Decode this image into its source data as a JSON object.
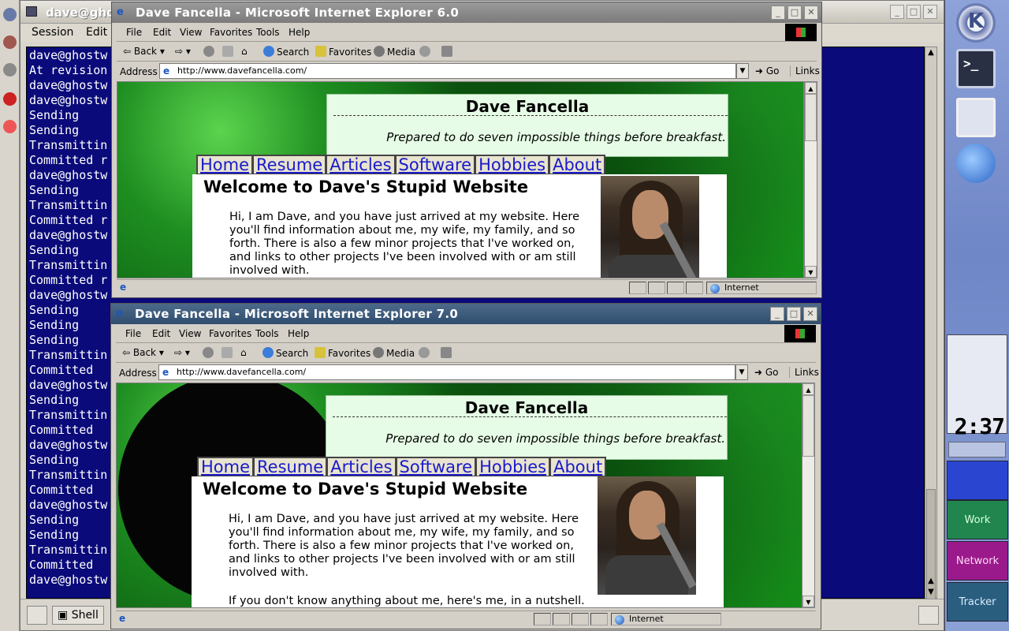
{
  "konsole": {
    "title": "dave@ghos",
    "menu": [
      "Session",
      "Edit"
    ],
    "lines": [
      "dave@ghostw",
      "At revision",
      "dave@ghostw",
      "dave@ghostw",
      "Sending",
      "Sending",
      "Transmittin",
      "Committed r",
      "dave@ghostw",
      "Sending",
      "Transmittin",
      "Committed r",
      "dave@ghostw",
      "Sending",
      "Transmittin",
      "Committed r",
      "dave@ghostw",
      "Sending",
      "Sending",
      "Sending",
      "Transmittin",
      "Committed",
      "dave@ghostw",
      "Sending",
      "Transmittin",
      "Committed",
      "dave@ghostw",
      "Sending",
      "Transmittin",
      "Committed",
      "dave@ghostw",
      "Sending",
      "Sending",
      "Transmittin",
      "Committed",
      "dave@ghostw"
    ],
    "taskbar_shell": "Shell"
  },
  "ie6": {
    "title": "Dave Fancella - Microsoft Internet Explorer 6.0",
    "address": "http://www.davefancella.com/"
  },
  "ie7": {
    "title": "Dave Fancella - Microsoft Internet Explorer 7.0",
    "address": "http://www.davefancella.com/"
  },
  "browser_ui": {
    "menu": [
      "File",
      "Edit",
      "View",
      "Favorites",
      "Tools",
      "Help"
    ],
    "back": "Back",
    "search": "Search",
    "favorites": "Favorites",
    "media": "Media",
    "address_label": "Address",
    "go": "Go",
    "links": "Links",
    "zone": "Internet"
  },
  "site": {
    "name": "Dave Fancella",
    "tagline": "Prepared to do seven impossible things before breakfast.",
    "nav": [
      "Home",
      "Resume",
      "Articles",
      "Software",
      "Hobbies",
      "About"
    ],
    "heading": "Welcome to Dave's Stupid Website",
    "intro": "Hi, I am Dave, and you have just arrived at my website. Here you'll find information about me, my wife, my family, and so forth. There is also a few minor projects that I've worked on, and links to other projects I've been involved with or am still involved with.",
    "nutshell": "If you don't know anything about me, here's me, in a nutshell."
  },
  "kde_panel": {
    "clock": "2:37",
    "desktops": [
      "Work",
      "Network",
      "Tracker"
    ]
  }
}
